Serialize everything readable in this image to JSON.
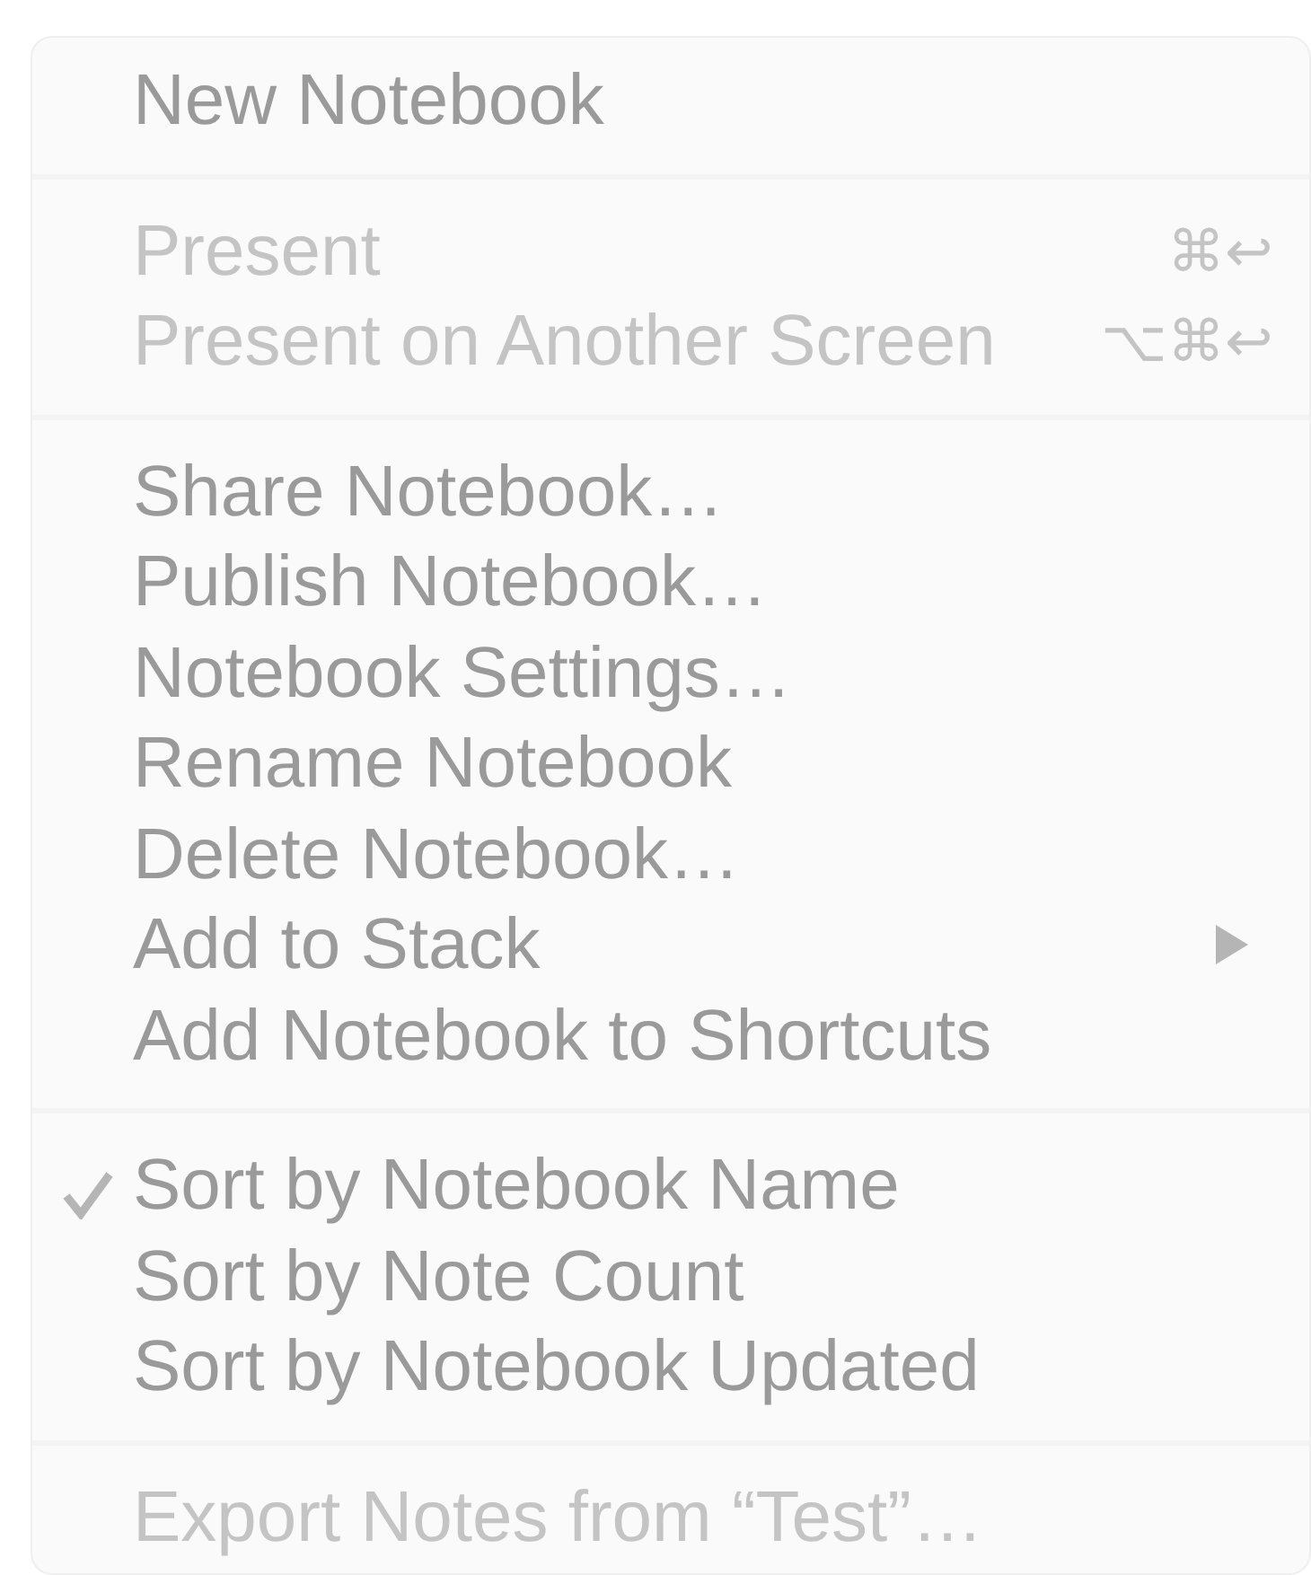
{
  "menu": {
    "sections": [
      {
        "items": [
          {
            "kind": "item",
            "label": "New Notebook",
            "disabled": false,
            "checked": false
          }
        ]
      },
      {
        "items": [
          {
            "kind": "item",
            "label": "Present",
            "disabled": true,
            "checked": false,
            "shortcut": "⌘↩"
          },
          {
            "kind": "item",
            "label": "Present on Another Screen",
            "disabled": true,
            "checked": false,
            "shortcut": "⌥⌘↩"
          }
        ]
      },
      {
        "items": [
          {
            "kind": "item",
            "label": "Share Notebook…",
            "disabled": false,
            "checked": false
          },
          {
            "kind": "item",
            "label": "Publish Notebook…",
            "disabled": false,
            "checked": false
          },
          {
            "kind": "item",
            "label": "Notebook Settings…",
            "disabled": false,
            "checked": false
          },
          {
            "kind": "item",
            "label": "Rename Notebook",
            "disabled": false,
            "checked": false
          },
          {
            "kind": "item",
            "label": "Delete Notebook…",
            "disabled": false,
            "checked": false
          },
          {
            "kind": "submenu",
            "label": "Add to Stack",
            "disabled": false,
            "checked": false
          },
          {
            "kind": "item",
            "label": "Add Notebook to Shortcuts",
            "disabled": false,
            "checked": false
          }
        ]
      },
      {
        "items": [
          {
            "kind": "item",
            "label": "Sort by Notebook Name",
            "disabled": false,
            "checked": true
          },
          {
            "kind": "item",
            "label": "Sort by Note Count",
            "disabled": false,
            "checked": false
          },
          {
            "kind": "item",
            "label": "Sort by Notebook Updated",
            "disabled": false,
            "checked": false
          }
        ]
      },
      {
        "items": [
          {
            "kind": "item",
            "label": "Export Notes from “Test”…",
            "disabled": true,
            "checked": false
          }
        ]
      }
    ]
  }
}
